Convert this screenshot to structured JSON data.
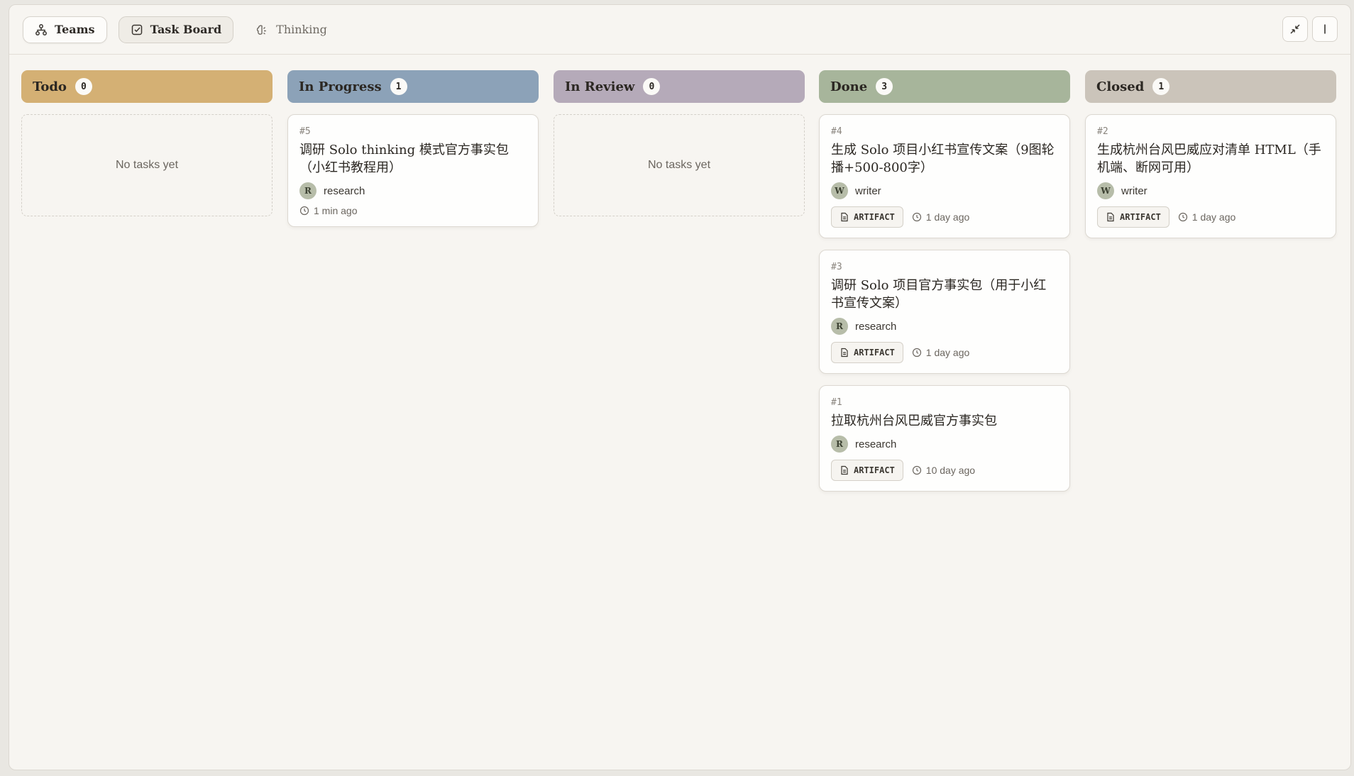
{
  "nav": {
    "tabs": [
      {
        "label": "Teams",
        "icon": "hierarchy-icon"
      },
      {
        "label": "Task Board",
        "icon": "checkbox-icon"
      },
      {
        "label": "Thinking",
        "icon": "brain-icon"
      }
    ]
  },
  "colors": {
    "todo": "#d4b074",
    "in_progress": "#8ca2b8",
    "in_review": "#b5aab9",
    "done": "#a7b59b",
    "closed": "#cbc4ba"
  },
  "columns": [
    {
      "title": "Todo",
      "count": "0",
      "empty_text": "No tasks yet"
    },
    {
      "title": "In Progress",
      "count": "1"
    },
    {
      "title": "In Review",
      "count": "0",
      "empty_text": "No tasks yet"
    },
    {
      "title": "Done",
      "count": "3"
    },
    {
      "title": "Closed",
      "count": "1"
    }
  ],
  "cards": {
    "c5": {
      "id": "#5",
      "title": "调研 Solo thinking 模式官方事实包（小红书教程用）",
      "assignee_initial": "R",
      "assignee": "research",
      "time": "1 min ago"
    },
    "c4": {
      "id": "#4",
      "title": "生成 Solo 项目小红书宣传文案（9图轮播+500-800字）",
      "assignee_initial": "W",
      "assignee": "writer",
      "artifact": "ARTIFACT",
      "time": "1 day ago"
    },
    "c3": {
      "id": "#3",
      "title": "调研 Solo 项目官方事实包（用于小红书宣传文案）",
      "assignee_initial": "R",
      "assignee": "research",
      "artifact": "ARTIFACT",
      "time": "1 day ago"
    },
    "c1": {
      "id": "#1",
      "title": "拉取杭州台风巴威官方事实包",
      "assignee_initial": "R",
      "assignee": "research",
      "artifact": "ARTIFACT",
      "time": "10 day ago"
    },
    "c2": {
      "id": "#2",
      "title": "生成杭州台风巴威应对清单 HTML（手机端、断网可用）",
      "assignee_initial": "W",
      "assignee": "writer",
      "artifact": "ARTIFACT",
      "time": "1 day ago"
    }
  }
}
